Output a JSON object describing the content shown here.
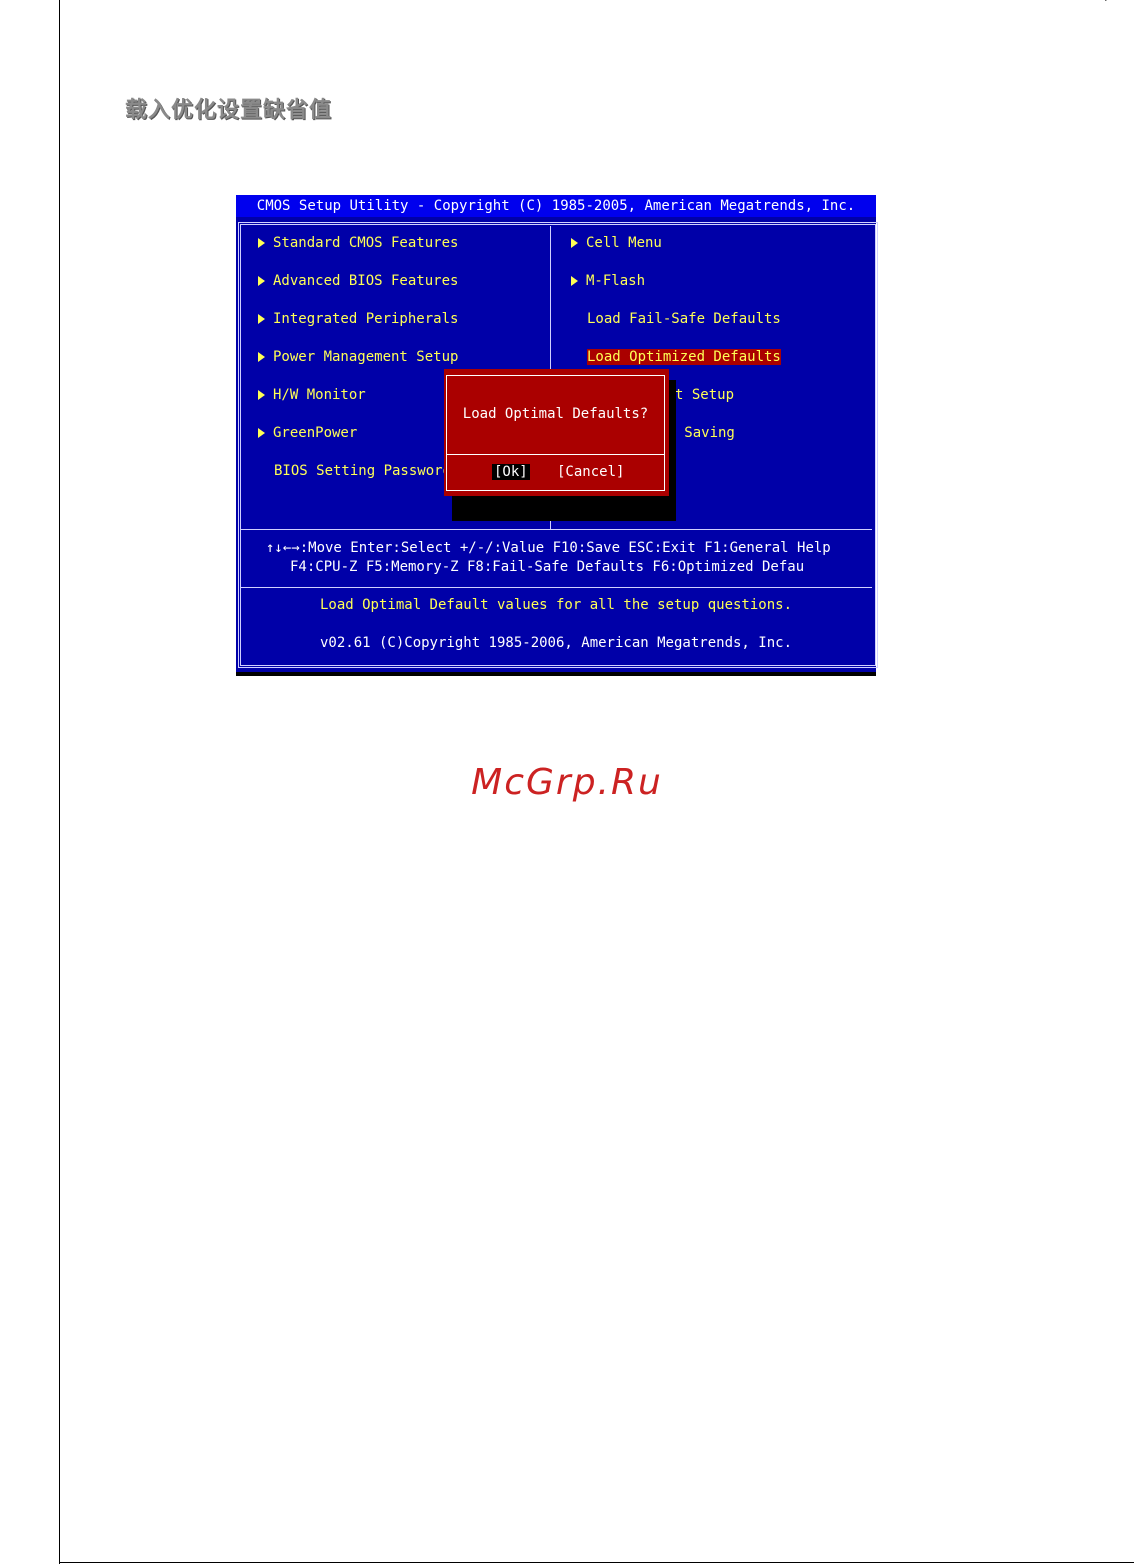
{
  "heading": "载入优化设置缺省值",
  "bios": {
    "title": "CMOS Setup Utility - Copyright (C) 1985-2005, American Megatrends, Inc.",
    "left_menu": [
      {
        "label": "Standard CMOS Features",
        "submenu": true
      },
      {
        "label": "Advanced BIOS Features",
        "submenu": true
      },
      {
        "label": "Integrated Peripherals",
        "submenu": true
      },
      {
        "label": "Power Management Setup",
        "submenu": true
      },
      {
        "label": "H/W Monitor",
        "submenu": true
      },
      {
        "label": "GreenPower",
        "submenu": true
      },
      {
        "label": "BIOS Setting Password",
        "submenu": false
      }
    ],
    "right_menu": [
      {
        "label": "Cell Menu",
        "submenu": true
      },
      {
        "label": "M-Flash",
        "submenu": true
      },
      {
        "label": "Load Fail-Safe Defaults",
        "submenu": false
      },
      {
        "label": "Load Optimized Defaults",
        "submenu": false,
        "selected": true
      },
      {
        "label": "t Setup",
        "submenu": false
      },
      {
        "label": "ut Saving",
        "submenu": false
      }
    ],
    "help_line_1": "↑↓←→:Move  Enter:Select  +/-/:Value  F10:Save  ESC:Exit  F1:General Help",
    "help_line_2": "F4:CPU-Z    F5:Memory-Z     F8:Fail-Safe Defaults    F6:Optimized Defau",
    "status": "Load Optimal Default values for all the setup questions.",
    "copyright": "v02.61 (C)Copyright 1985-2006, American Megatrends, Inc.",
    "dialog": {
      "question": "Load Optimal Defaults?",
      "ok": "[Ok]",
      "cancel": "[Cancel]"
    }
  },
  "watermark": "McGrp.Ru",
  "colors": {
    "bios_bg": "#0000a8",
    "title_bg": "#0000ee",
    "menu_text": "#ffff55",
    "dialog_bg": "#aa0000"
  }
}
